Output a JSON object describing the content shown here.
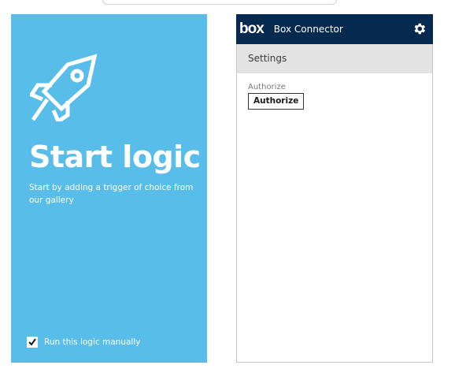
{
  "left_panel": {
    "title": "Start logic",
    "description": "Start by adding a trigger of choice from our gallery",
    "manual_run": {
      "label": "Run this logic manually",
      "checked": true
    },
    "icon": "rocket-icon",
    "background_color": "#59bde9"
  },
  "connector": {
    "logo": "box",
    "title": "Box Connector",
    "settings_icon": "gear-icon",
    "header_color": "#06294f",
    "settings_tab_label": "Settings",
    "authorize_label": "Authorize",
    "authorize_button_label": "Authorize"
  }
}
